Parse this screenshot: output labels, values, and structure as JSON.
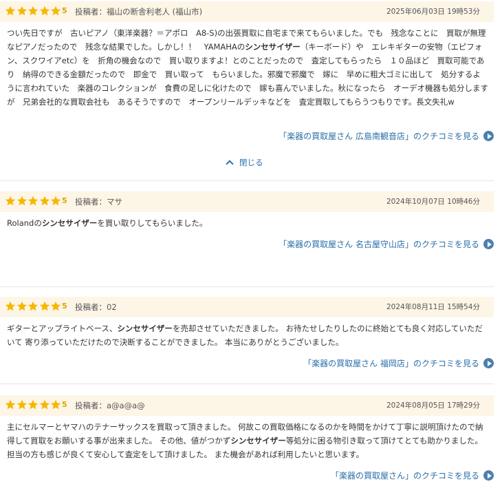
{
  "reviews": [
    {
      "rating": "5",
      "poster": "投稿者：福山の断舎利老人 (福山市)",
      "date": "2025年06月03日 19時53分",
      "body": [
        {
          "t": "つい先日ですが　古いピアノ（東洋楽器？＝アポロ　A8-S)の出張買取に自宅まで来てもらいました。でも　残念なことに　買取が無理なピアノだったので　残念な結果でした。しかし！！　YAMAHAの"
        },
        {
          "t": "シンセサイザー",
          "b": true
        },
        {
          "t": "（キーボード）や　エレキギターの安物（エピフォン、スクワイアetc）を　折角の機会なので　買い取りますよ！とのことだったので　査定してもらったら　１０品ほど　買取可能であり　納得のできる金額だったので　即金で　買い取って　もらいました。邪魔で邪魔で　嫁に　早めに粗大ゴミに出して　処分するように言われていた　楽器のコレクションが　食費の足しに化けたので　嫁も喜んでいました。秋になったら　オーデオ機器も処分しますが　兄弟会社的な買取会社も　あるそうですので　オープンリールデッキなどを　査定買取してもらうつもりです。長文失礼w"
        }
      ],
      "link": "「楽器の買取屋さん 広島南観音店」のクチコミを見る"
    },
    {
      "rating": "5",
      "poster": "投稿者：マサ",
      "date": "2024年10月07日 10時46分",
      "body": [
        {
          "t": "Rolandの"
        },
        {
          "t": "シンセサイザー",
          "b": true
        },
        {
          "t": "を買い取りしてもらいました。"
        }
      ],
      "link": "「楽器の買取屋さん 名古屋守山店」のクチコミを見る"
    },
    {
      "rating": "5",
      "poster": "投稿者：02",
      "date": "2024年08月11日 15時54分",
      "body": [
        {
          "t": "ギターとアップライトベース、"
        },
        {
          "t": "シンセサイザー",
          "b": true
        },
        {
          "t": "を売却させていただきました。 お待たせしたりしたのに終始とても良く対応していただいて 寄り添っていただけたので決断することができました。 本当にありがとうございました。"
        }
      ],
      "link": "「楽器の買取屋さん 福岡店」のクチコミを見る"
    },
    {
      "rating": "5",
      "poster": "投稿者：a@a@a@",
      "date": "2024年08月05日 17時29分",
      "body": [
        {
          "t": "主にセルマーとヤマハのテナーサックスを買取って頂きました。 何故この買取価格になるのかを時間をかけて丁寧に説明頂けたので納得して買取をお願いする事が出来ました。 その他、値がつかず"
        },
        {
          "t": "シンセサイザー",
          "b": true
        },
        {
          "t": "等処分に困る物引き取って頂けてとても助かりました。 担当の方も感じが良くて安心して査定をして頂けました。 また機会があれば利用したいと思います。"
        }
      ],
      "link": "「楽器の買取屋さん」のクチコミを見る"
    }
  ],
  "close_label": "閉じる",
  "colors": {
    "star": "#f5b700",
    "header_bg": "#fdf5e6",
    "link": "#2a6fa8"
  },
  "icons": {
    "star": "star-icon",
    "link_arrow": "play-circle-icon",
    "close": "chevron-up-icon"
  }
}
